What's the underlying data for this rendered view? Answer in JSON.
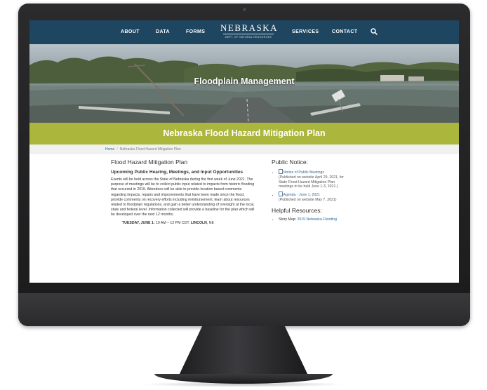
{
  "nav": {
    "items": [
      "ABOUT",
      "DATA",
      "FORMS",
      "SERVICES",
      "CONTACT"
    ],
    "logo_main": "NEBRASKA",
    "logo_sub": "DEPT. OF NATURAL RESOURCES",
    "search_icon": "search-icon"
  },
  "hero": {
    "title": "Floodplain Management"
  },
  "banner": {
    "title": "Nebraska Flood Hazard Mitigation Plan"
  },
  "breadcrumb": {
    "home": "Home",
    "separator": "/",
    "current": "Nebraska Flood Hazard Mitigation Plan"
  },
  "main": {
    "heading": "Flood Hazard Mitigation Plan",
    "subheading": "Upcoming Public Hearing, Meetings, and Input Opportunities",
    "paragraph": "Events will be held across the State of Nebraska during the first week of June 2021. The purpose of meetings will be to collect public input related to impacts from historic flooding that occurred in 2019. Attendees will be able to provide location based comments regarding impacts, repairs and improvements that have been made since the flood, provide comments on recovery efforts including reimbursement, learn about resources related to floodplain regulations, and gain a better understanding of oversight at the local, state and federal level. Information collected will provide a baseline for the plan which will be developed over the next 12 months.",
    "event_day": "TUESDAY, JUNE 1:",
    "event_time": " 10 AM – 12 PM CDT: ",
    "event_place": "LINCOLN",
    "event_state": ", NE"
  },
  "sidebar": {
    "public_notice_heading": "Public Notice:",
    "notices": [
      {
        "link": "Notice of Public Meetings",
        "note": "(Published on website April 29, 2021, for State Flood Hazard Mitigation Plan meetings to be held June 1-3, 2021.)"
      },
      {
        "link": "Agenda - June 1, 2021",
        "note": "(Published on website May 7, 2021)"
      }
    ],
    "resources_heading": "Helpful Resources:",
    "resources": [
      {
        "prefix": "Story Map: ",
        "link": "2019 Nebraska Flooding"
      }
    ]
  },
  "colors": {
    "nav_bg": "#1f4660",
    "banner_bg": "#aab73c",
    "link": "#2e6e9e"
  }
}
